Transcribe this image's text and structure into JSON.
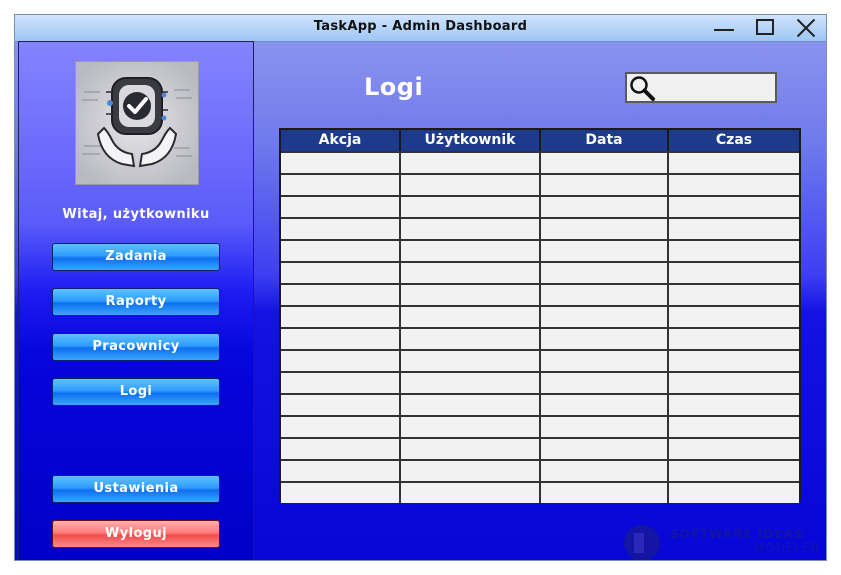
{
  "window": {
    "title": "TaskApp - Admin Dashboard"
  },
  "sidebar": {
    "welcome": "Witaj, użytkowniku",
    "nav": {
      "tasks": "Zadania",
      "reports": "Raporty",
      "employees": "Pracownicy",
      "logs": "Logi",
      "settings": "Ustawienia",
      "logout": "Wyloguj"
    }
  },
  "main": {
    "title": "Logi",
    "search": {
      "value": "",
      "placeholder": ""
    },
    "table": {
      "columns": [
        "Akcja",
        "Użytkownik",
        "Data",
        "Czas"
      ],
      "rows": 16
    }
  },
  "watermark": {
    "line1": "SOFTWARE IDEAS",
    "line2": "MODELER"
  }
}
